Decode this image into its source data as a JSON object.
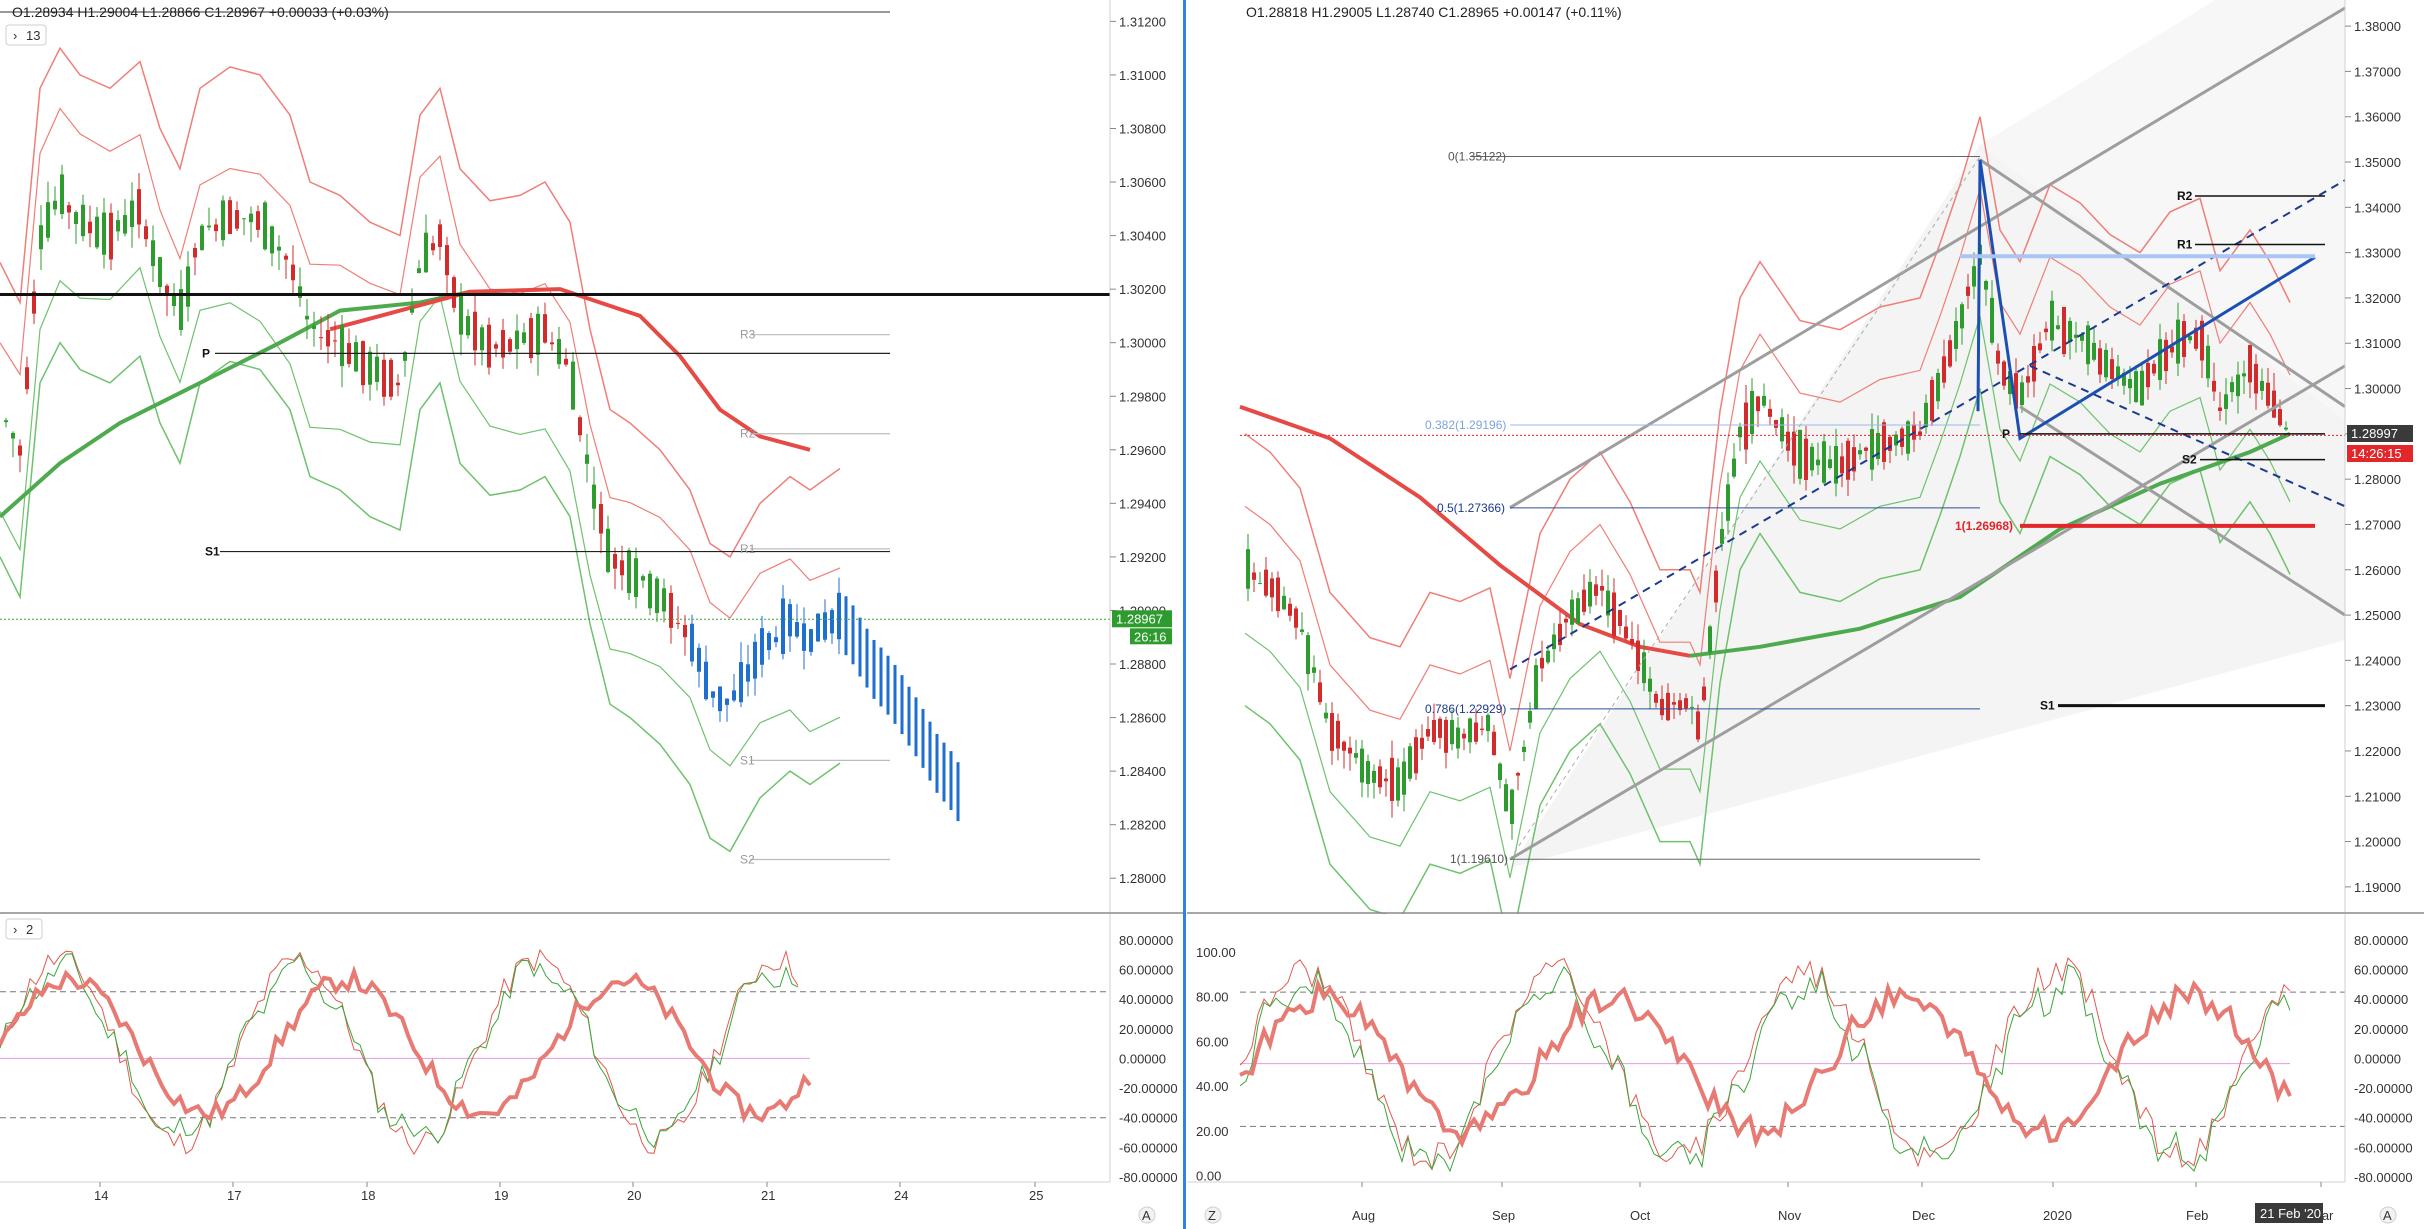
{
  "chart_data": [
    {
      "type": "candlestick",
      "panel": "left-price",
      "ohlc_header": "O1.28934  H1.29004  L1.28866  C1.28967  +0.00033 (+0.03%)",
      "pane_tag": "13",
      "ylim": [
        1.279,
        1.3125
      ],
      "y_ticks": [
        "1.31200",
        "1.31000",
        "1.30800",
        "1.30600",
        "1.30400",
        "1.30200",
        "1.30000",
        "1.29800",
        "1.29600",
        "1.29400",
        "1.29200",
        "1.29000",
        "1.28800",
        "1.28600",
        "1.28400",
        "1.28200",
        "1.28000"
      ],
      "x_ticks": [
        "14",
        "17",
        "18",
        "19",
        "20",
        "21",
        "24",
        "25"
      ],
      "last_price_label": "1.28967",
      "countdown_label": "26:16",
      "pivot_levels": [
        {
          "label": "P",
          "value": 1.2996
        },
        {
          "label": "S1",
          "value": 1.2922
        },
        {
          "label": "R3",
          "value": 1.3003
        },
        {
          "label": "R2",
          "value": 1.2966
        },
        {
          "label": "R1",
          "value": 1.2923
        },
        {
          "label": "S1",
          "value": 1.2844
        },
        {
          "label": "S2",
          "value": 1.2807
        }
      ],
      "horizontal_line": 1.3018
    },
    {
      "type": "line",
      "panel": "left-oscillator",
      "pane_tag": "2",
      "ylim": [
        -82,
        90
      ],
      "y_ticks": [
        "80.00000",
        "60.00000",
        "40.00000",
        "20.00000",
        "0.00000",
        "-20.00000",
        "-40.00000",
        "-60.00000",
        "-80.00000"
      ],
      "levels": [
        45,
        -40,
        0
      ]
    },
    {
      "type": "candlestick",
      "panel": "right-price",
      "ohlc_header": "O1.28818  H1.29005  L1.28740  C1.28965  +0.00147 (+0.11%)",
      "ylim": [
        1.186,
        1.384
      ],
      "y_ticks": [
        "1.38000",
        "1.37000",
        "1.36000",
        "1.35000",
        "1.34000",
        "1.33000",
        "1.32000",
        "1.31000",
        "1.30000",
        "1.29000",
        "1.28000",
        "1.27000",
        "1.26000",
        "1.25000",
        "1.24000",
        "1.23000",
        "1.22000",
        "1.21000",
        "1.20000",
        "1.19000"
      ],
      "x_ticks": [
        "Aug",
        "Sep",
        "Oct",
        "Nov",
        "Dec",
        "2020",
        "Feb",
        "Mar"
      ],
      "last_price_label": "1.28997",
      "countdown_label": "14:26:15",
      "fib_levels": [
        {
          "label": "0(1.35122)",
          "value": 1.35122
        },
        {
          "label": "0.382(1.29196)",
          "value": 1.29196
        },
        {
          "label": "0.5(1.27366)",
          "value": 1.27366
        },
        {
          "label": "0.786(1.22929)",
          "value": 1.22929
        },
        {
          "label": "1(1.19610)",
          "value": 1.1961
        },
        {
          "label": "1(1.26968)",
          "value": 1.26968
        }
      ],
      "pivot_levels": [
        {
          "label": "R2",
          "value": 1.3425
        },
        {
          "label": "R1",
          "value": 1.3318
        },
        {
          "label": "P",
          "value": 1.29
        },
        {
          "label": "S2",
          "value": 1.2843
        },
        {
          "label": "S1",
          "value": 1.23
        }
      ]
    },
    {
      "type": "line",
      "panel": "right-oscillator",
      "ylim": [
        -2,
        112
      ],
      "y_ticks": [
        "100.00",
        "80.00",
        "60.00",
        "40.00",
        "20.00",
        "0.00"
      ],
      "right_y_ticks": [
        "80.00000",
        "60.00000",
        "40.00000",
        "20.00000",
        "0.00000",
        "-20.00000",
        "-40.00000",
        "-60.00000",
        "-80.00000"
      ],
      "levels": [
        82,
        22,
        50
      ]
    }
  ],
  "footer": {
    "left_corner": "Z",
    "right_corner": "A",
    "date_badge": "21 Feb '20"
  },
  "colors": {
    "candle_up": "#2e9b2e",
    "candle_down": "#d22b2b",
    "blue_bars": "#1e6fd0",
    "band_red": "#ef7e78",
    "band_green": "#6ec26e",
    "ma_red": "#e64a45",
    "ma_green": "#4faa4f",
    "channel": "#9e9e9e",
    "fib": "#6b6b6b"
  }
}
